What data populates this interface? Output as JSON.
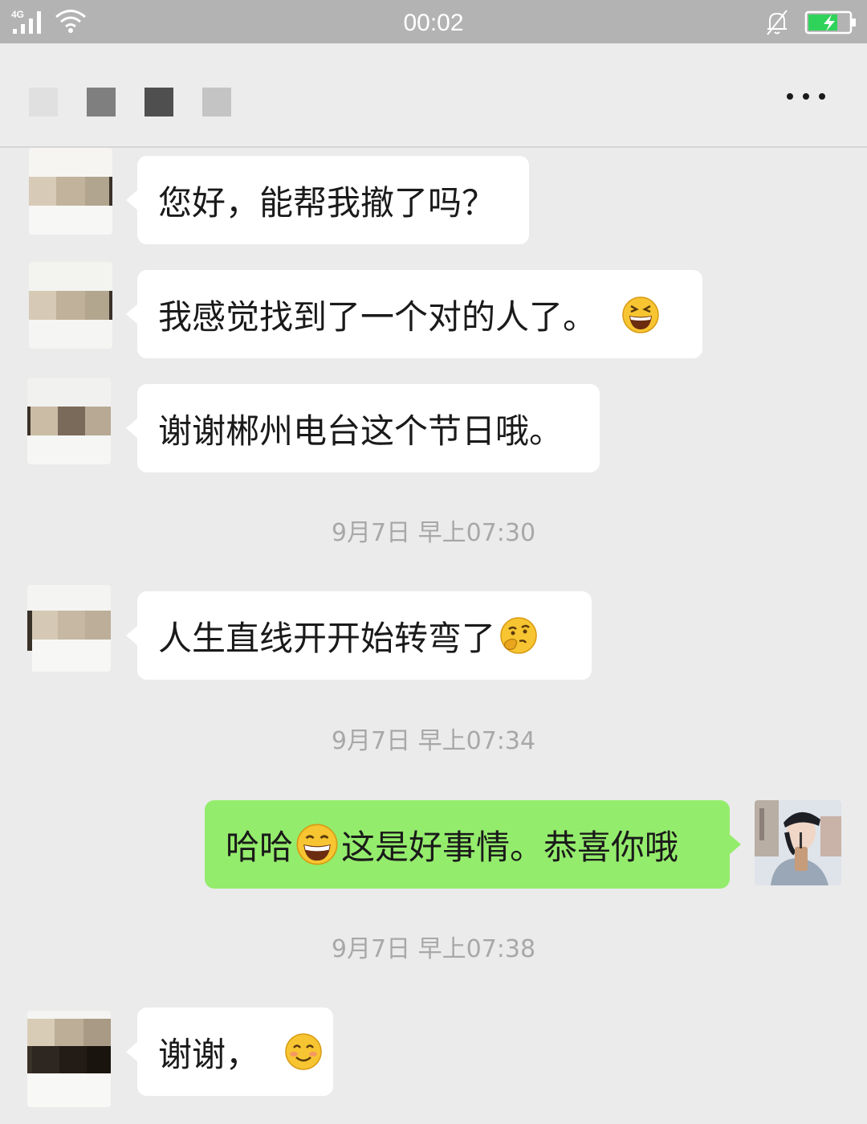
{
  "status_bar": {
    "network": "4G",
    "time": "00:02"
  },
  "header": {
    "more_icon": "more-dots-icon"
  },
  "messages": [
    {
      "side": "left",
      "text": "您好，能帮我撤了吗？"
    },
    {
      "side": "left",
      "text": "我感觉找到了一个对的人了。",
      "emoji": "grinning-emoji"
    },
    {
      "side": "left",
      "text": "谢谢郴州电台这个节日哦。"
    },
    {
      "type": "timestamp",
      "text": "9月7日 早上07:30"
    },
    {
      "side": "left",
      "text": "人生直线开开始转弯了",
      "emoji": "thinking-emoji"
    },
    {
      "type": "timestamp",
      "text": "9月7日 早上07:34"
    },
    {
      "side": "right",
      "text_before": "哈哈",
      "emoji": "laughing-emoji",
      "text_after": "这是好事情。恭喜你哦"
    },
    {
      "type": "timestamp",
      "text": "9月7日 早上07:38"
    },
    {
      "side": "left",
      "text": "谢谢，",
      "emoji": "smiling-emoji"
    }
  ],
  "colors": {
    "background": "#ebebeb",
    "sent_bubble": "#94ec6c",
    "received_bubble": "#ffffff",
    "timestamp_text": "#a8a8a8",
    "status_bar": "#b3b3b3"
  }
}
